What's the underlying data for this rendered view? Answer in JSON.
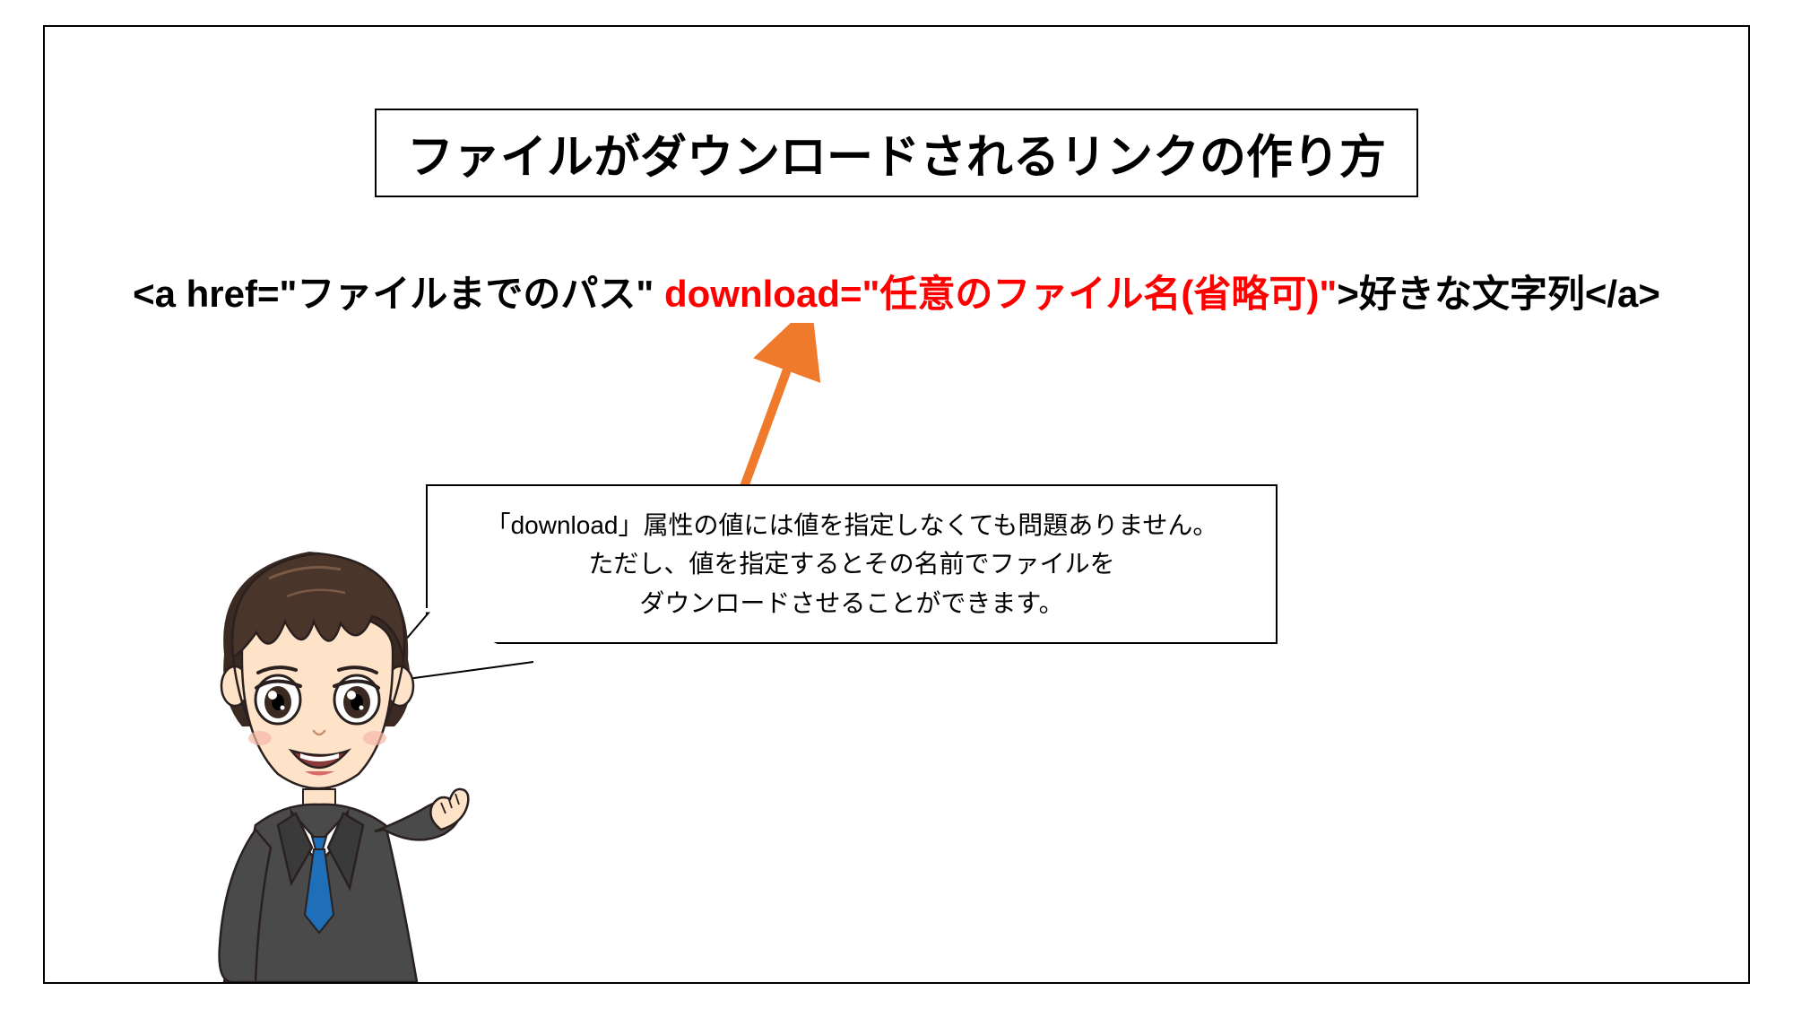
{
  "title": "ファイルがダウンロードされるリンクの作り方",
  "code": {
    "p1": "<a href=\"ファイルまでのパス\" ",
    "red": "download=\"任意のファイル名(省略可)\"",
    "p2": ">好きな文字列</a>"
  },
  "explain": {
    "l1": "「download」属性の値には値を指定しなくても問題ありません。",
    "l2": "ただし、値を指定するとその名前でファイルを",
    "l3": "ダウンロードさせることができます。"
  },
  "colors": {
    "arrow": "#f07a2b",
    "highlight": "#ff0000"
  }
}
